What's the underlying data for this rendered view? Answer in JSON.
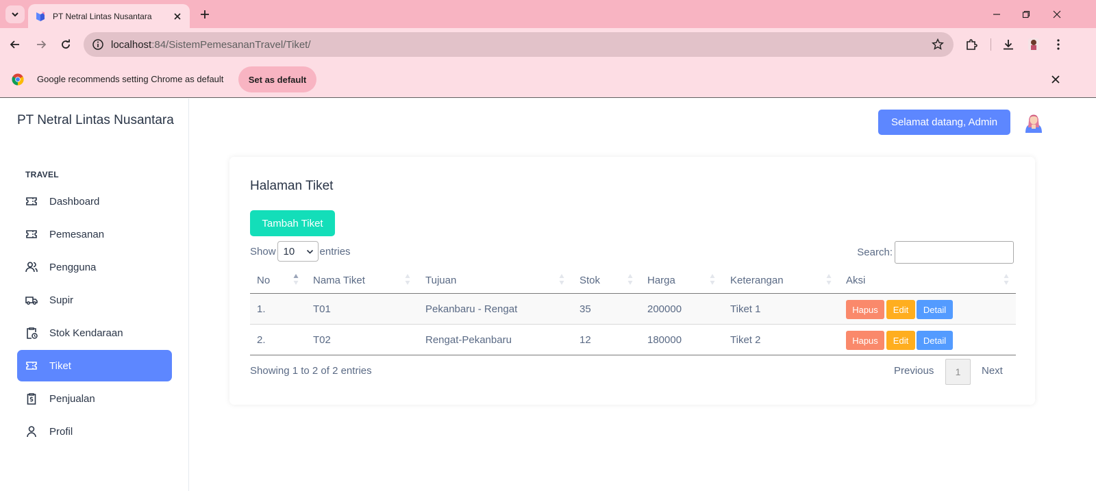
{
  "browser": {
    "tab_title": "PT Netral Lintas Nusantara",
    "url_host": "localhost",
    "url_path": ":84/SistemPemesananTravel/Tiket/",
    "infobar_text": "Google recommends setting Chrome as default",
    "set_default_label": "Set as default"
  },
  "sidebar": {
    "brand": "PT Netral Lintas Nusantara",
    "caption": "TRAVEL",
    "items": [
      {
        "label": "Dashboard",
        "icon": "ticket-icon"
      },
      {
        "label": "Pemesanan",
        "icon": "ticket-icon"
      },
      {
        "label": "Pengguna",
        "icon": "users-icon"
      },
      {
        "label": "Supir",
        "icon": "truck-icon"
      },
      {
        "label": "Stok Kendaraan",
        "icon": "clipboard-clock-icon"
      },
      {
        "label": "Tiket",
        "icon": "ticket-icon",
        "active": true
      },
      {
        "label": "Penjualan",
        "icon": "receipt-dollar-icon"
      },
      {
        "label": "Profil",
        "icon": "user-icon"
      }
    ]
  },
  "header": {
    "welcome_label": "Selamat datang, Admin"
  },
  "page": {
    "title": "Halaman Tiket",
    "add_button": "Tambah Tiket",
    "show_label": "Show",
    "entries_value": "10",
    "entries_label": "entries",
    "search_label": "Search:",
    "search_value": "",
    "columns": [
      "No",
      "Nama Tiket",
      "Tujuan",
      "Stok",
      "Harga",
      "Keterangan",
      "Aksi"
    ],
    "rows": [
      {
        "no": "1.",
        "nama": "T01",
        "tujuan": "Pekanbaru - Rengat",
        "stok": "35",
        "harga": "200000",
        "ket": "Tiket 1"
      },
      {
        "no": "2.",
        "nama": "T02",
        "tujuan": "Rengat-Pekanbaru",
        "stok": "12",
        "harga": "180000",
        "ket": "Tiket 2"
      }
    ],
    "actions": {
      "hapus": "Hapus",
      "edit": "Edit",
      "detail": "Detail"
    },
    "info": "Showing 1 to 2 of 2 entries",
    "pagination": {
      "previous": "Previous",
      "current": "1",
      "next": "Next"
    }
  },
  "colors": {
    "primary": "#5d87ff",
    "success": "#13deb9",
    "danger": "#fa896b",
    "warning": "#ffae1f",
    "info": "#539bff",
    "chrome_bg": "#fddde4"
  }
}
